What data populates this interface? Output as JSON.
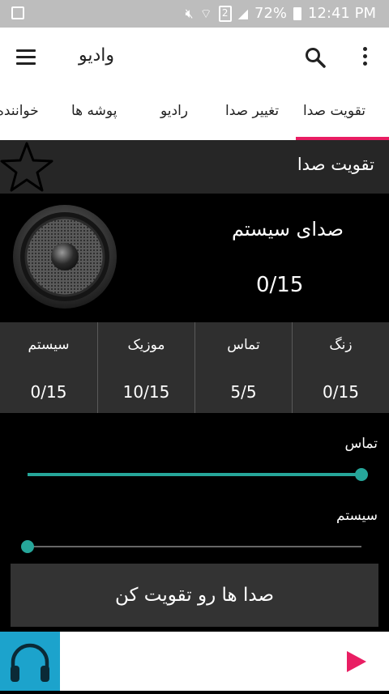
{
  "status_bar": {
    "battery": "72%",
    "time": "12:41 PM",
    "sim": "2"
  },
  "toolbar": {
    "title": "وادیو"
  },
  "tabs": [
    {
      "label": "تقویت صدا",
      "active": true
    },
    {
      "label": "تغییر صدا"
    },
    {
      "label": "رادیو"
    },
    {
      "label": "پوشه ها"
    },
    {
      "label": "خواننده"
    }
  ],
  "section": {
    "title": "تقویت صدا"
  },
  "hero": {
    "label": "صدای سیستم",
    "value": "0/15"
  },
  "stats": [
    {
      "label": "زنگ",
      "value": "0/15"
    },
    {
      "label": "تماس",
      "value": "5/5"
    },
    {
      "label": "موزیک",
      "value": "10/15"
    },
    {
      "label": "سیستم",
      "value": "0/15"
    }
  ],
  "sliders": [
    {
      "label": "تماس",
      "fraction": 1.0
    },
    {
      "label": "سیستم",
      "fraction": 0.0
    }
  ],
  "boost_button": {
    "label": "صدا ها رو تقویت کن"
  },
  "colors": {
    "accent": "#e91e63",
    "slider": "#26a69a",
    "headphone_tile": "#1ca3cc"
  }
}
